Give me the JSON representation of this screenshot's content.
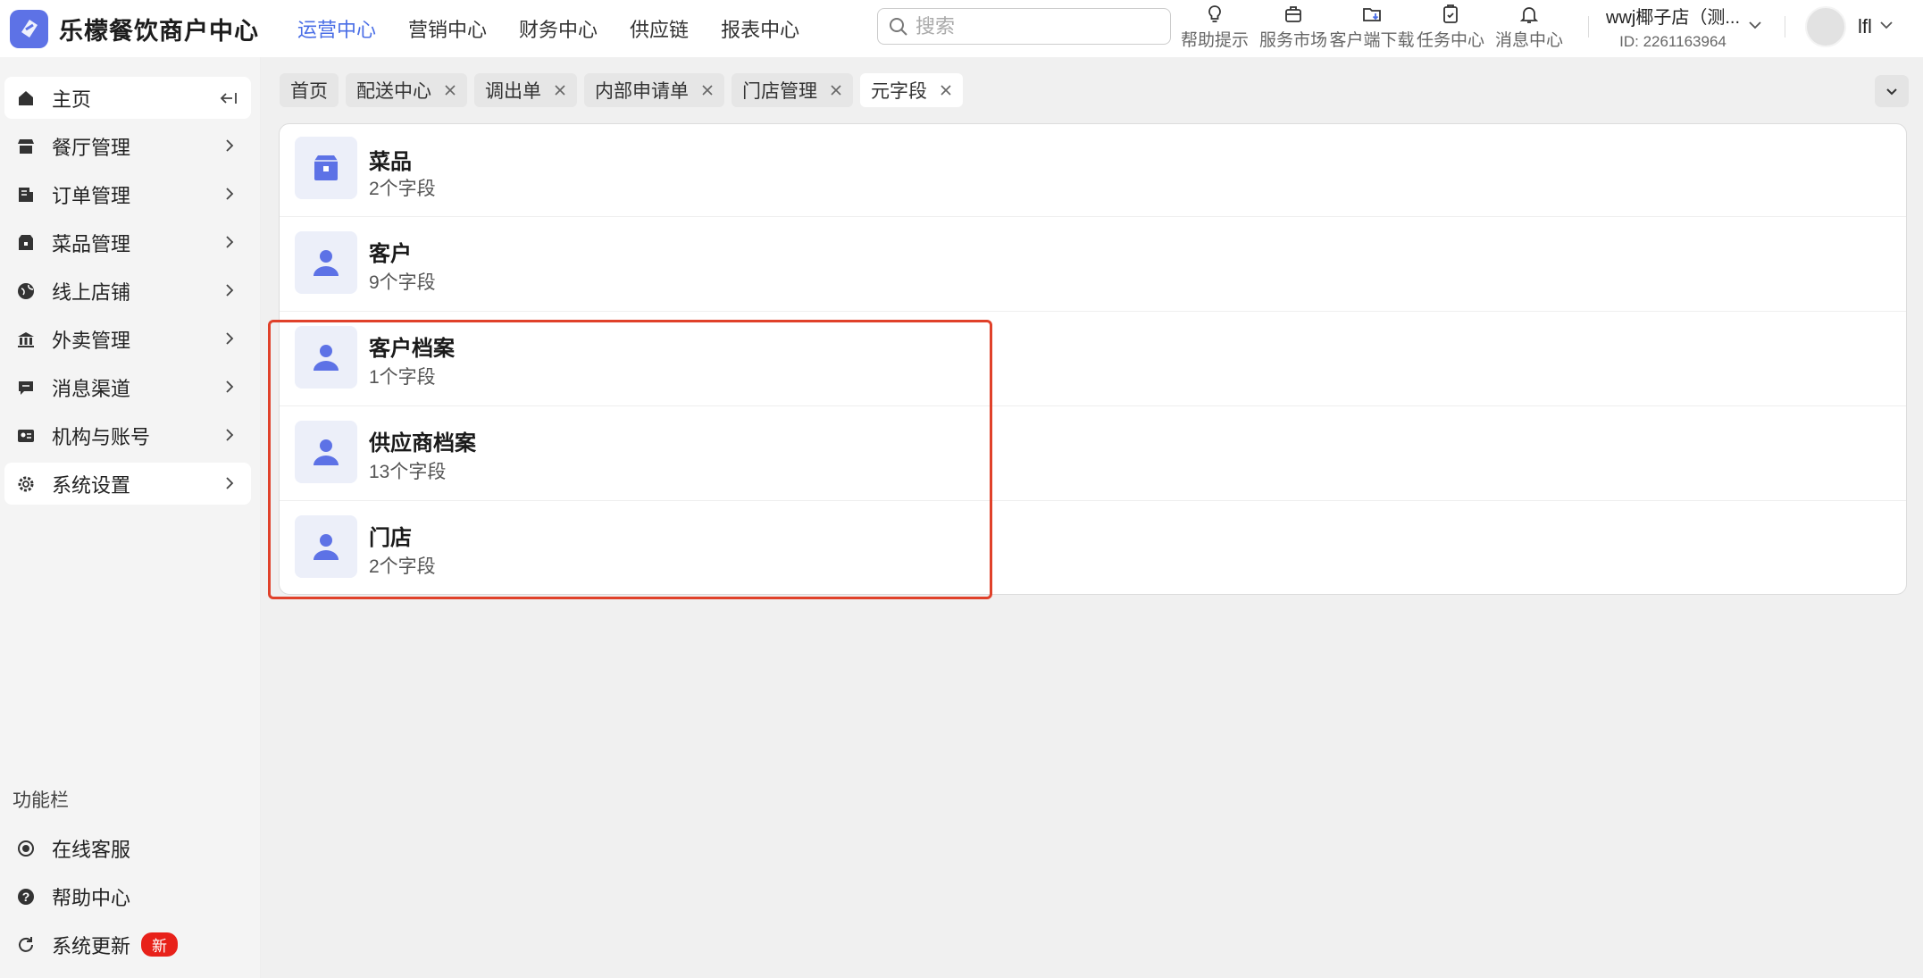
{
  "app": {
    "title": "乐檬餐饮商户中心"
  },
  "top_nav": [
    "运营中心",
    "营销中心",
    "财务中心",
    "供应链",
    "报表中心"
  ],
  "search": {
    "placeholder": "搜索"
  },
  "tools": [
    {
      "label": "帮助提示",
      "icon": "lightbulb-icon"
    },
    {
      "label": "服务市场",
      "icon": "briefcase-icon"
    },
    {
      "label": "客户端下载",
      "icon": "folder-download-icon"
    },
    {
      "label": "任务中心",
      "icon": "clipboard-check-icon"
    },
    {
      "label": "消息中心",
      "icon": "bell-icon"
    }
  ],
  "account": {
    "name": "wwj椰子店（测...",
    "id": "ID: 2261163964"
  },
  "user": {
    "name": "lfl"
  },
  "sidebar": {
    "items": [
      {
        "label": "主页",
        "icon": "home-icon"
      },
      {
        "label": "餐厅管理",
        "icon": "store-icon"
      },
      {
        "label": "订单管理",
        "icon": "order-icon"
      },
      {
        "label": "菜品管理",
        "icon": "dish-box-icon"
      },
      {
        "label": "线上店铺",
        "icon": "globe-icon"
      },
      {
        "label": "外卖管理",
        "icon": "bank-icon"
      },
      {
        "label": "消息渠道",
        "icon": "chat-icon"
      },
      {
        "label": "机构与账号",
        "icon": "id-card-icon"
      },
      {
        "label": "系统设置",
        "icon": "gear-icon"
      }
    ],
    "func_title": "功能栏",
    "func_items": [
      {
        "label": "在线客服",
        "icon": "customer-service-icon"
      },
      {
        "label": "帮助中心",
        "icon": "question-icon"
      },
      {
        "label": "系统更新",
        "icon": "refresh-icon",
        "badge": "新"
      }
    ]
  },
  "tabs": [
    {
      "label": "首页",
      "closable": false
    },
    {
      "label": "配送中心",
      "closable": true
    },
    {
      "label": "调出单",
      "closable": true
    },
    {
      "label": "内部申请单",
      "closable": true
    },
    {
      "label": "门店管理",
      "closable": true
    },
    {
      "label": "元字段",
      "closable": true,
      "active": true
    }
  ],
  "entities": [
    {
      "name": "菜品",
      "count": "2个字段",
      "icon": "dish-box-icon"
    },
    {
      "name": "客户",
      "count": "9个字段",
      "icon": "person-icon"
    },
    {
      "name": "客户档案",
      "count": "1个字段",
      "icon": "person-icon"
    },
    {
      "name": "供应商档案",
      "count": "13个字段",
      "icon": "person-icon"
    },
    {
      "name": "门店",
      "count": "2个字段",
      "icon": "person-icon"
    }
  ],
  "colors": {
    "accent": "#4a6ee6",
    "icon": "#5d72e6",
    "highlight": "#e0412a",
    "badge": "#e8211a"
  }
}
